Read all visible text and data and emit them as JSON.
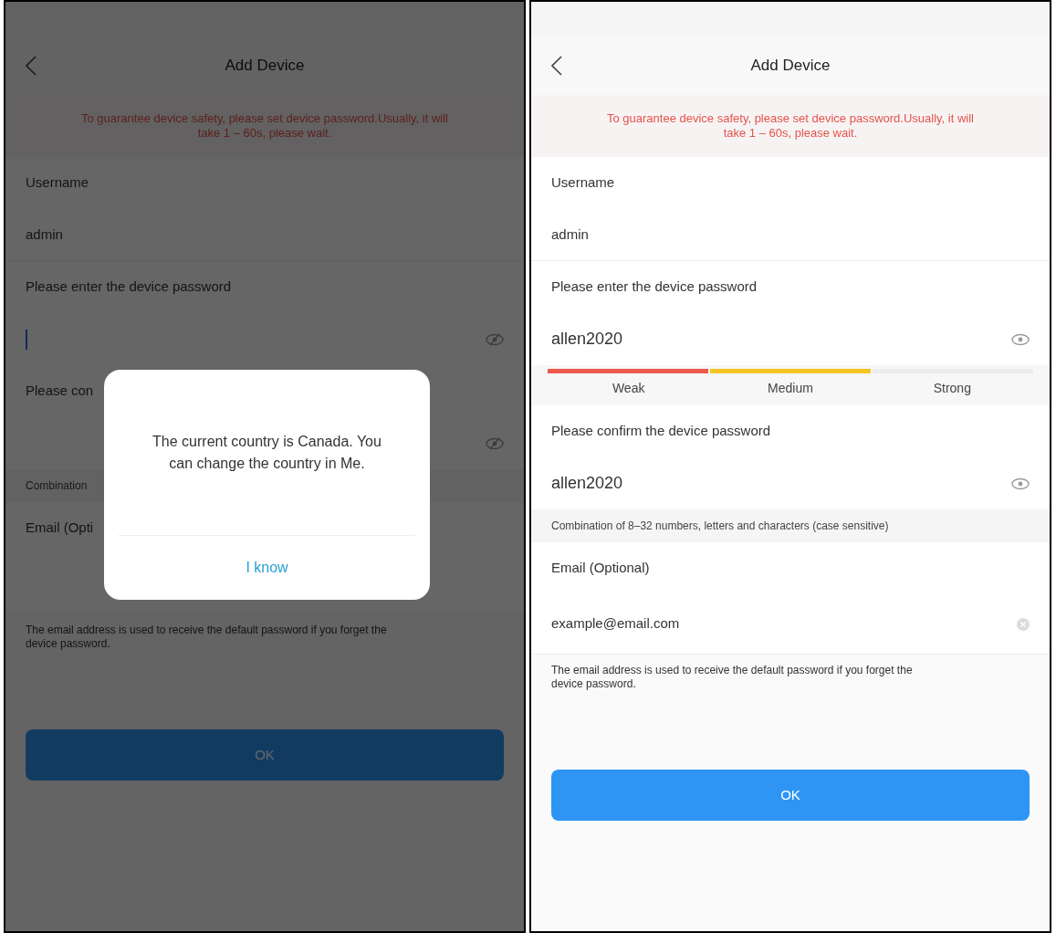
{
  "screens": [
    {
      "title": "Add Device",
      "notice": "To guarantee device safety, please set device password.Usually, it will take 1 – 60s, please wait.",
      "sections": [
        {
          "kind": "label",
          "text": "Username"
        },
        {
          "kind": "value",
          "text": "admin"
        },
        {
          "kind": "label",
          "text": "Please enter the device password"
        },
        {
          "kind": "password",
          "focused": true,
          "visible": false
        },
        {
          "kind": "label",
          "text": "Please con"
        },
        {
          "kind": "password",
          "focused": false,
          "visible": false
        },
        {
          "kind": "note",
          "text": "Combination"
        },
        {
          "kind": "label",
          "text": "Email (Opti"
        },
        {
          "kind": "email"
        },
        {
          "kind": "info",
          "text": "The email address is used to receive the default password if you forget the device password."
        }
      ],
      "button": "OK",
      "dialog": {
        "message": "The current country is Canada. You can change the country in Me.",
        "button": "I know"
      }
    },
    {
      "title": "Add Device",
      "notice": "To guarantee device safety, please set device password.Usually, it will take 1 – 60s, please wait.",
      "sections": [
        {
          "kind": "label",
          "text": "Username"
        },
        {
          "kind": "value",
          "text": "admin"
        },
        {
          "kind": "label",
          "text": "Please enter the device password"
        },
        {
          "kind": "password",
          "value": "allen2020",
          "focused": false,
          "visible": true
        },
        {
          "kind": "strength",
          "segments": [
            {
              "label": "Weak",
              "on": true,
              "color": "#ec5a4e"
            },
            {
              "label": "Medium",
              "on": true,
              "color": "#f3c623"
            },
            {
              "label": "Strong",
              "on": false
            }
          ]
        },
        {
          "kind": "label",
          "text": "Please confirm the device password"
        },
        {
          "kind": "password",
          "value": "allen2020",
          "focused": false,
          "visible": true
        },
        {
          "kind": "note",
          "text": "Combination of 8–32 numbers, letters and characters (case sensitive)"
        },
        {
          "kind": "label",
          "text": "Email (Optional)"
        },
        {
          "kind": "email",
          "value": "example@email.com",
          "clearable": true
        },
        {
          "kind": "info",
          "text": "The email address is used to receive the default password if you forget the device password."
        }
      ],
      "button": "OK"
    }
  ]
}
